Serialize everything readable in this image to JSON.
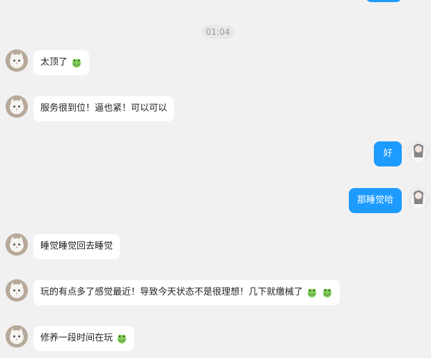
{
  "timestamp": "01:04",
  "messages": [
    {
      "side": "left",
      "text": "太顶了",
      "emoji": [
        "frog-face-emoji"
      ]
    },
    {
      "side": "left",
      "text": "服务很到位！逼也紧！可以可以",
      "emoji": []
    },
    {
      "side": "right",
      "text": "好",
      "emoji": []
    },
    {
      "side": "right",
      "text": "那睡觉哈",
      "emoji": []
    },
    {
      "side": "left",
      "text": "睡觉睡觉回去睡觉",
      "emoji": []
    },
    {
      "side": "left",
      "text": "玩的有点多了感觉最近！导致今天状态不是很理想！几下就缴械了",
      "emoji": [
        "frog-face-emoji",
        "frog-face-emoji"
      ]
    },
    {
      "side": "left",
      "text": "修养一段时间在玩",
      "emoji": [
        "frog-face-emoji"
      ]
    }
  ],
  "colors": {
    "background": "#f1f1f1",
    "outgoing_bubble": "#1e9bff",
    "incoming_bubble": "#ffffff",
    "timestamp_text": "#9a9a9a"
  }
}
